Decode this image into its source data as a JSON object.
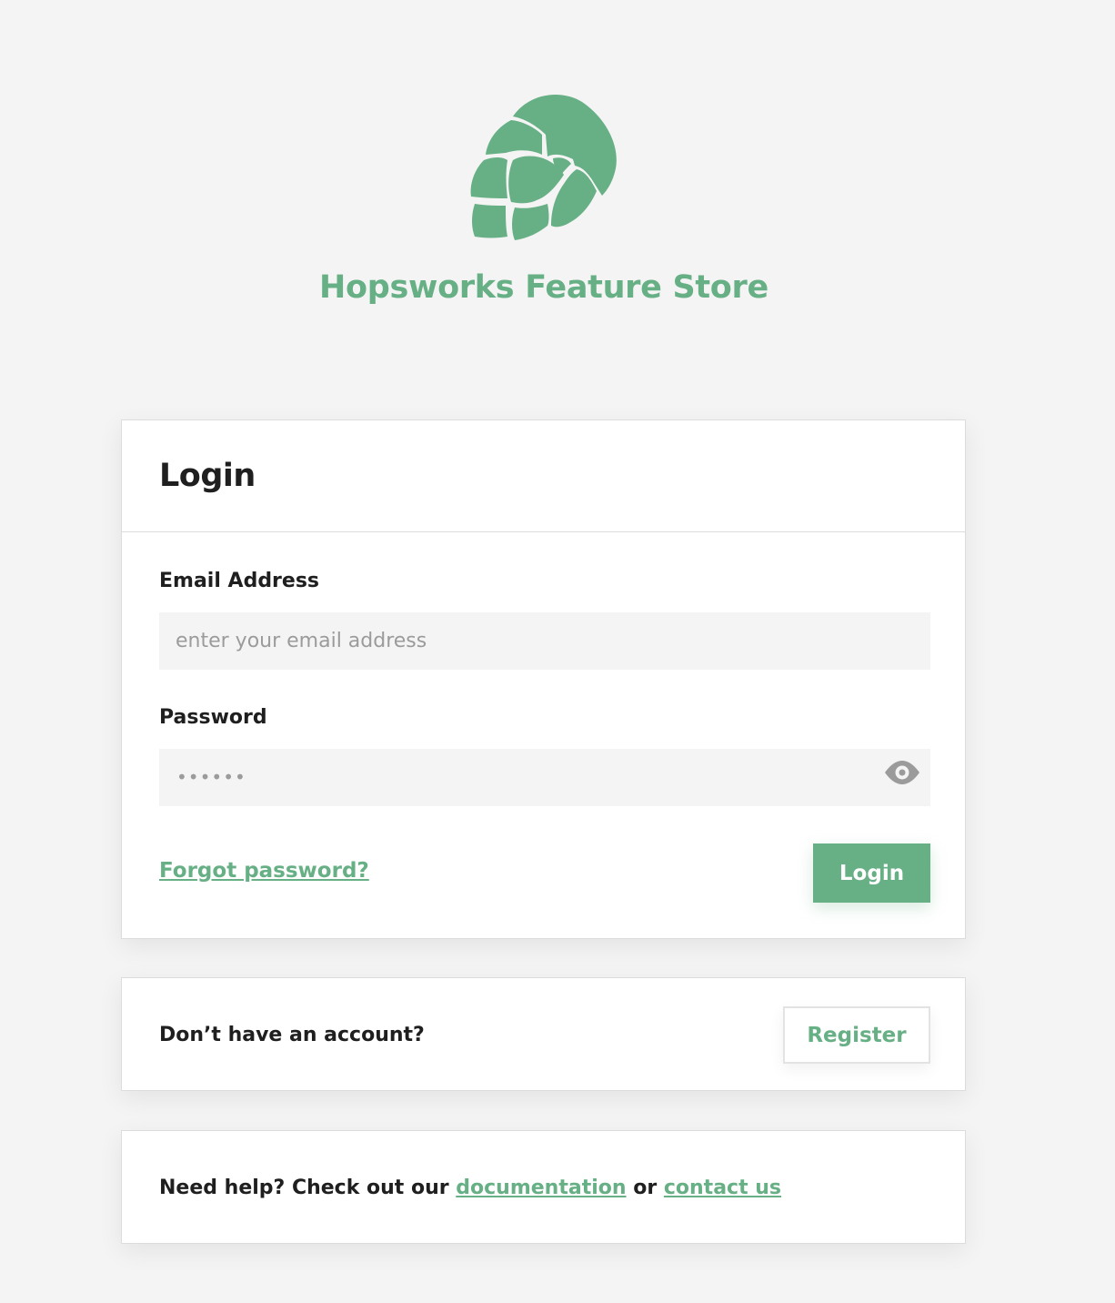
{
  "brand": {
    "title": "Hopsworks Feature Store",
    "accent_color": "#67b085",
    "logo_icon": "hop-cone-icon"
  },
  "login": {
    "title": "Login",
    "email_label": "Email Address",
    "email_placeholder": "enter your email address",
    "email_value": "",
    "password_label": "Password",
    "password_value": "••••••",
    "password_toggle_icon": "eye-icon",
    "forgot_label": "Forgot password?",
    "submit_label": "Login"
  },
  "register": {
    "prompt": "Don’t have an account?",
    "button_label": "Register"
  },
  "help": {
    "prefix": "Need help? Check out our",
    "documentation_label": "documentation",
    "middle": "or",
    "contact_label": "contact us"
  }
}
